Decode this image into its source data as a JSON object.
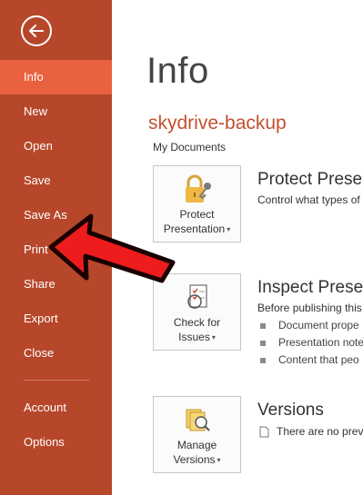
{
  "sidebar": {
    "back_label": "",
    "items": [
      {
        "label": "Info",
        "active": true
      },
      {
        "label": "New"
      },
      {
        "label": "Open"
      },
      {
        "label": "Save"
      },
      {
        "label": "Save As"
      },
      {
        "label": "Print"
      },
      {
        "label": "Share"
      },
      {
        "label": "Export"
      },
      {
        "label": "Close"
      },
      {
        "label": "Account"
      },
      {
        "label": "Options"
      }
    ],
    "color": "#b7472a",
    "active_color": "#e9613f"
  },
  "main": {
    "title": "Info",
    "doc_name": "skydrive-backup",
    "doc_path": "My Documents",
    "sections": [
      {
        "tile_label_1": "Protect",
        "tile_label_2": "Presentation",
        "title": "Protect Presen",
        "desc": "Control what types of"
      },
      {
        "tile_label_1": "Check for",
        "tile_label_2": "Issues",
        "title": "Inspect Presen",
        "desc": "Before publishing this",
        "bullets": [
          "Document prope",
          "Presentation note",
          "Content that peo"
        ]
      },
      {
        "tile_label_1": "Manage",
        "tile_label_2": "Versions",
        "title": "Versions",
        "desc": "There are no prev"
      }
    ]
  },
  "annotation": {
    "type": "red-arrow",
    "points_to": "Print"
  }
}
